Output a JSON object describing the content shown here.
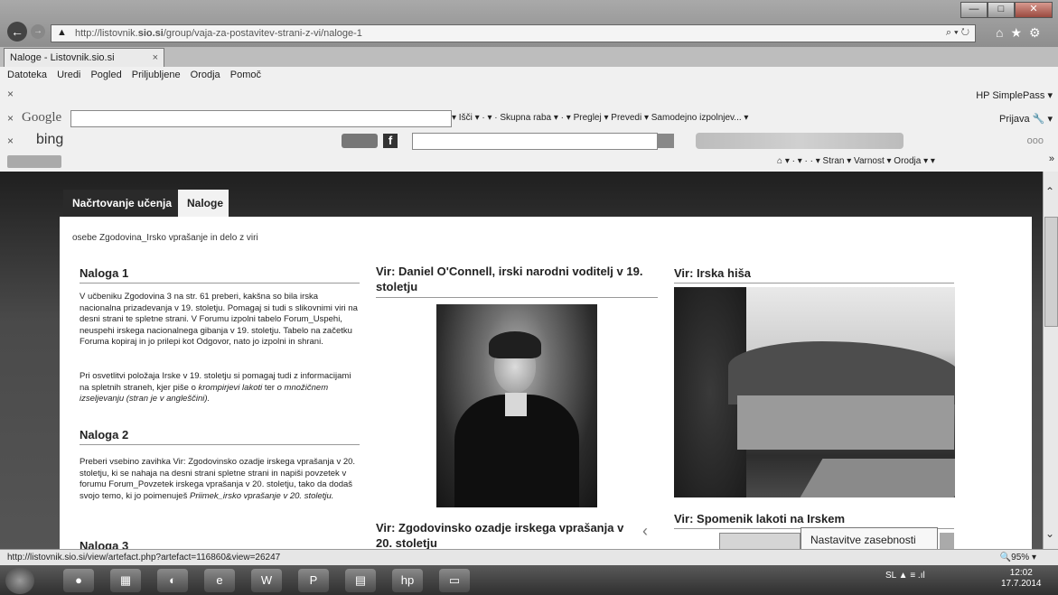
{
  "browser": {
    "url_prefix": "http://listovnik.",
    "url_bold": "sio.si",
    "url_suffix": "/group/vaja-za-postavitev-strani-z-vi/naloge-1",
    "address_controls": "⌕ ▾ ↻",
    "tab_title": "Naloge - Listovnik.sio.si",
    "tab_close": "×",
    "window_buttons": [
      "—",
      "□",
      "✕"
    ],
    "nav_icons": "⌂★⚙"
  },
  "menu": [
    "Datoteka",
    "Uredi",
    "Pogled",
    "Priljubljene",
    "Orodja",
    "Pomoč"
  ],
  "toolbars": {
    "hp_simplepass": "HP SimplePass ▾",
    "google_logo": "Google",
    "google_items": "▾  Išči ▾  ·  ▾  ·  Skupna raba ▾  ·  ▾   Preglej ▾   Prevedi ▾   Samodejno izpolnjev... ▾",
    "prijava": "Prijava 🔧 ▾",
    "bing_logo": "bing",
    "fav_items": "⌂ ▾ · ▾ · · ▾  Stran ▾  Varnost ▾  Orodja ▾  ▾",
    "close_x": "×",
    "more": "»",
    "dots": "ooo"
  },
  "page": {
    "tabs": [
      "Načrtovanje učenja",
      "Naloge"
    ],
    "breadcrumb": "osebe Zgodovina_Irsko vprašanje in delo z viri",
    "naloga1": {
      "title": "Naloga 1",
      "p1": "V učbeniku Zgodovina 3 na str. 61 preberi, kakšna so bila irska nacionalna prizadevanja v 19. stoletju. Pomagaj si tudi s slikovnimi viri na desni strani te spletne strani. V Forumu izpolni tabelo Forum_Uspehi, neuspehi irskega nacionalnega gibanja v 19. stoletju. Tabelo na začetku Foruma kopiraj in jo prilepi kot Odgovor, nato jo izpolni in shrani.",
      "p2_a": "Pri osvetlitvi položaja Irske v 19. stoletju si pomagaj tudi z informacijami na spletnih straneh, kjer piše o ",
      "p2_b": "krompirjevi lakoti",
      "p2_c": " ter ",
      "p2_d": "o množičnem izseljevanju (stran je v angleščini)."
    },
    "naloga2": {
      "title": "Naloga 2",
      "p1_a": "Preberi vsebino zavihka Vir: Zgodovinsko ozadje irskega vprašanja v 20. stoletju, ki se nahaja na desni strani spletne strani in napiši povzetek v forumu Forum_Povzetek irskega vprašanja v 20. stoletju, tako da dodaš svojo temo, ki jo poimenuješ ",
      "p1_b": "Priimek_irsko vprašanje v 20. stoletju."
    },
    "naloga3": {
      "title": "Naloga 3"
    },
    "vir_oconnell": "Vir: Daniel O'Connell, irski narodni voditelj v 19. stoletju",
    "vir_ozadje": "Vir: Zgodovinsko ozadje irskega vprašanja v 20. stoletju",
    "vir_hisa": "Vir: Irska hiša",
    "vir_spomenik": "Vir: Spomenik lakoti na Irskem",
    "tooltip": "Nastavitve zasebnosti",
    "chevron": "‹"
  },
  "status": {
    "link": "http://listovnik.sio.si/view/artefact.php?artefact=116860&view=26247",
    "zoom": "🔍95% ▾"
  },
  "taskbar": {
    "apps": [
      "●",
      "▦",
      "◐",
      "e",
      "W",
      "P",
      "▤",
      "hp",
      "▭"
    ],
    "tray": "SL   ▲  ≡ .ıl",
    "time": "12:02",
    "date": "17.7.2014"
  }
}
